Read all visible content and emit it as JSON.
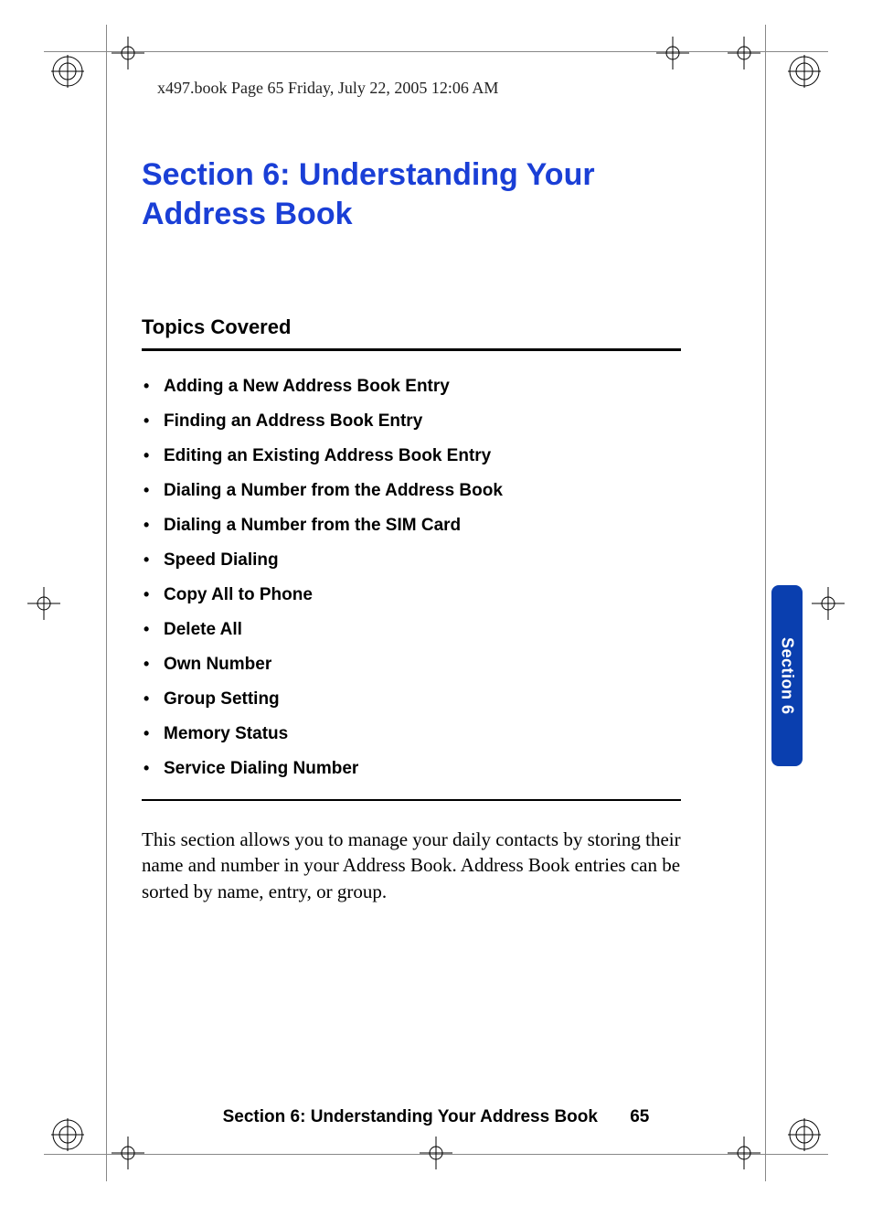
{
  "header": "x497.book  Page 65  Friday, July 22, 2005  12:06 AM",
  "title": "Section 6: Understanding Your Address Book",
  "topics_heading": "Topics Covered",
  "topics": [
    "Adding a New Address Book Entry",
    "Finding an Address Book Entry",
    "Editing an Existing Address Book Entry",
    "Dialing a Number from the Address Book",
    "Dialing a Number from the SIM Card",
    "Speed Dialing",
    "Copy All to Phone",
    "Delete All",
    "Own Number",
    "Group Setting",
    "Memory Status",
    "Service Dialing Number"
  ],
  "body": "This section allows you to manage your daily contacts by storing their name and number in your Address Book. Address Book entries can be sorted by name, entry, or group.",
  "tab_label": "Section 6",
  "footer_title": "Section 6: Understanding Your Address Book",
  "page_number": "65"
}
